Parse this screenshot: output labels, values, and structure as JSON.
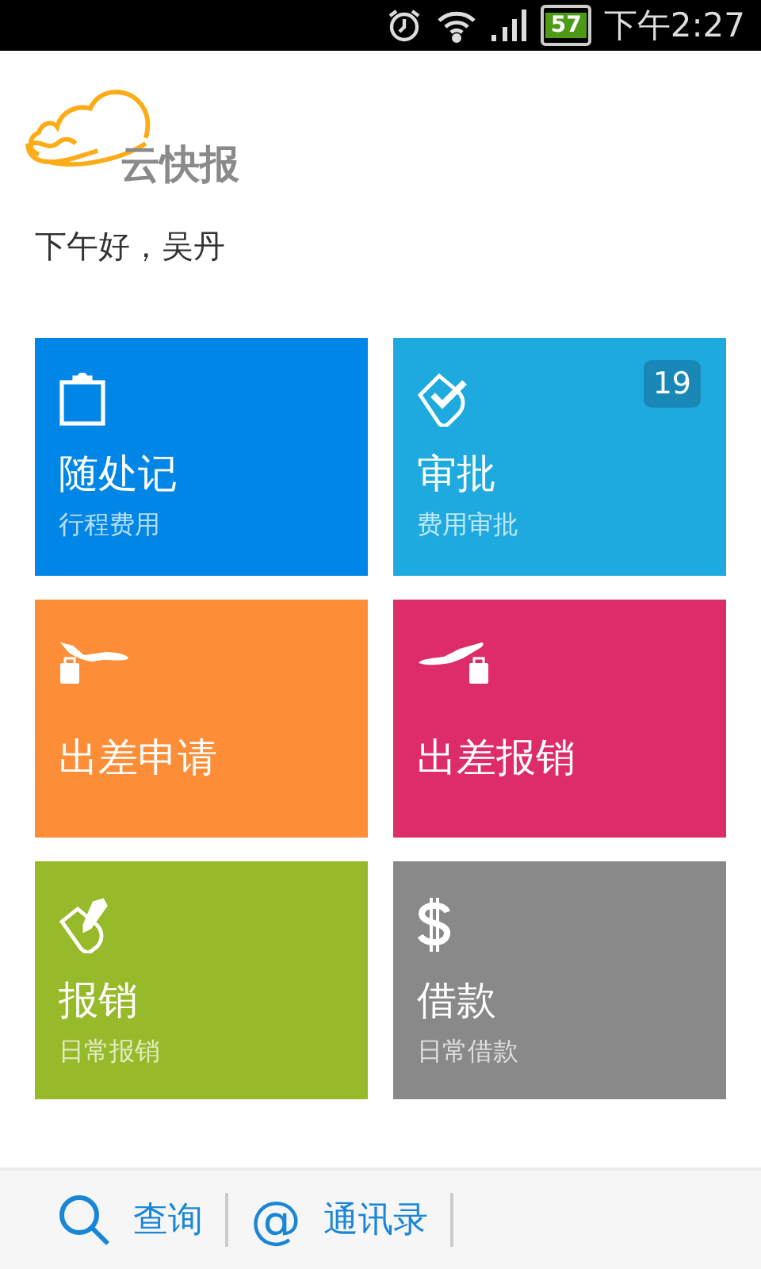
{
  "status_bar": {
    "battery": "57",
    "time": "下午2:27"
  },
  "app": {
    "logo_text": "云快报"
  },
  "greeting": "下午好，吴丹",
  "tiles": [
    {
      "kind": "clipboard",
      "title": "随处记",
      "subtitle": "行程费用",
      "color": "#0086e6"
    },
    {
      "kind": "approve",
      "title": "审批",
      "subtitle": "费用审批",
      "color": "#1eaadf"
    },
    {
      "kind": "depart",
      "title": "出差申请",
      "color": "#fd8d37"
    },
    {
      "kind": "arrive",
      "title": "出差报销",
      "color": "#dd2c69"
    },
    {
      "kind": "pen",
      "title": "报销",
      "subtitle": "日常报销",
      "color": "#97ba2a"
    },
    {
      "kind": "dollar",
      "title": "借款",
      "subtitle": "日常借款",
      "color": "#898989"
    }
  ],
  "approval_badge": "19",
  "bottom_nav": [
    {
      "kind": "search",
      "label": "查询"
    },
    {
      "kind": "at",
      "icon_text": "@",
      "label": "通讯录"
    }
  ]
}
